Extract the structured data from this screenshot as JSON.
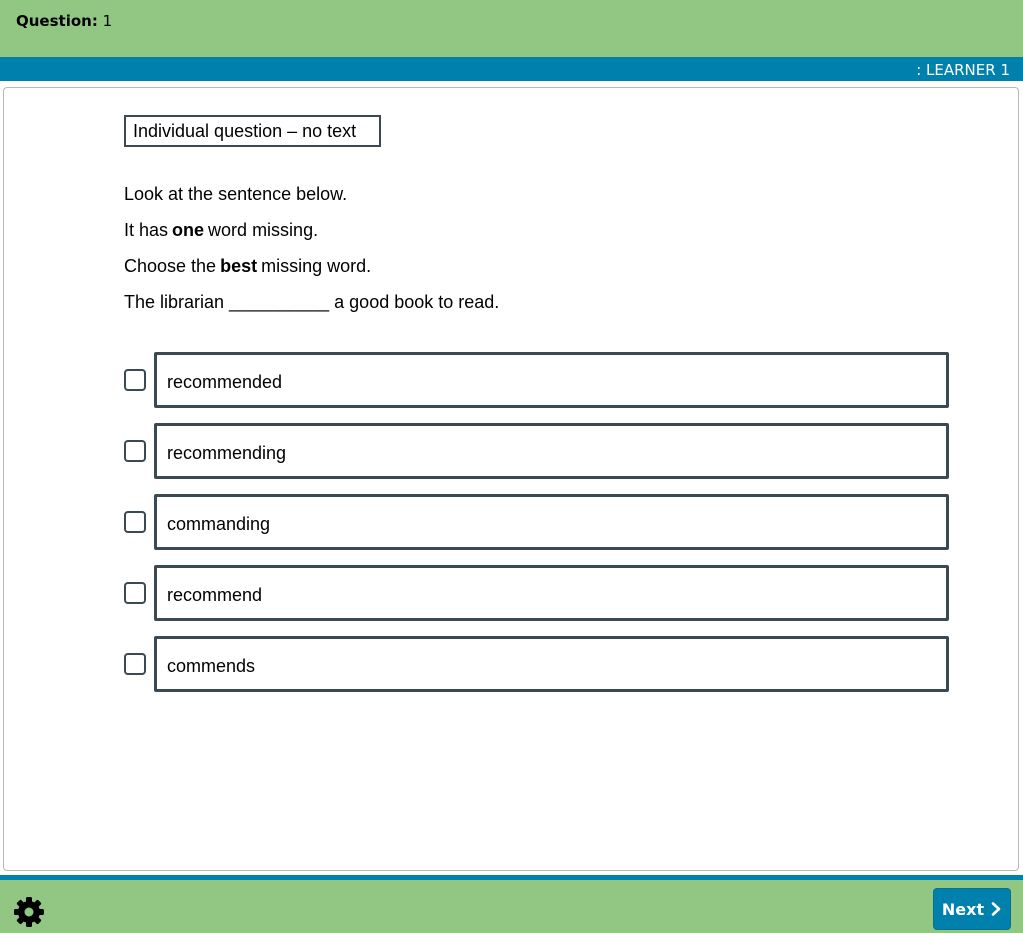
{
  "header": {
    "question_label": "Question:",
    "question_number": "1",
    "learner": ": LEARNER 1",
    "bg_color": "#91c783",
    "accent_color": "#0081ad"
  },
  "question": {
    "tag": "Individual question – no text",
    "line1": "Look at the sentence below.",
    "line2": {
      "before": "It has",
      "bold": "one",
      "after": "word missing."
    },
    "line3": {
      "before": "Choose the",
      "bold": "best",
      "after": "missing word."
    },
    "sentence": "The librarian __________ a good book to read."
  },
  "options": [
    {
      "label": "recommended",
      "checked": false
    },
    {
      "label": "recommending",
      "checked": false
    },
    {
      "label": "commanding",
      "checked": false
    },
    {
      "label": "recommend",
      "checked": false
    },
    {
      "label": "commends",
      "checked": false
    }
  ],
  "footer": {
    "settings_icon": "gear-icon",
    "next_label": "Next",
    "next_icon": "chevron-right-icon"
  }
}
